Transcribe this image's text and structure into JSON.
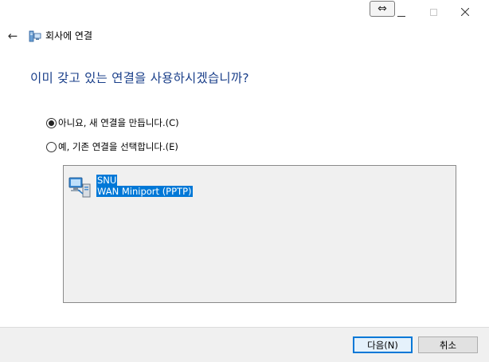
{
  "window": {
    "resize_glyph": "⇔",
    "icons": [
      "resize-icon",
      "minimize-icon",
      "maximize-icon",
      "close-icon"
    ]
  },
  "header": {
    "back_glyph": "←",
    "title": "회사에 연결"
  },
  "heading": "이미 갖고 있는 연결을 사용하시겠습니까?",
  "options": [
    {
      "label": "아니요, 새 연결을 만듭니다.(C)",
      "selected": true
    },
    {
      "label": "예, 기존 연결을 선택합니다.(E)",
      "selected": false
    }
  ],
  "connections": [
    {
      "name": "SNU",
      "device": "WAN Miniport (PPTP)",
      "selected": true
    }
  ],
  "footer": {
    "next_label": "다음(N)",
    "cancel_label": "취소"
  },
  "colors": {
    "heading": "#1a3f8a",
    "selection": "#0078d7",
    "default_button_border": "#0078d7"
  }
}
